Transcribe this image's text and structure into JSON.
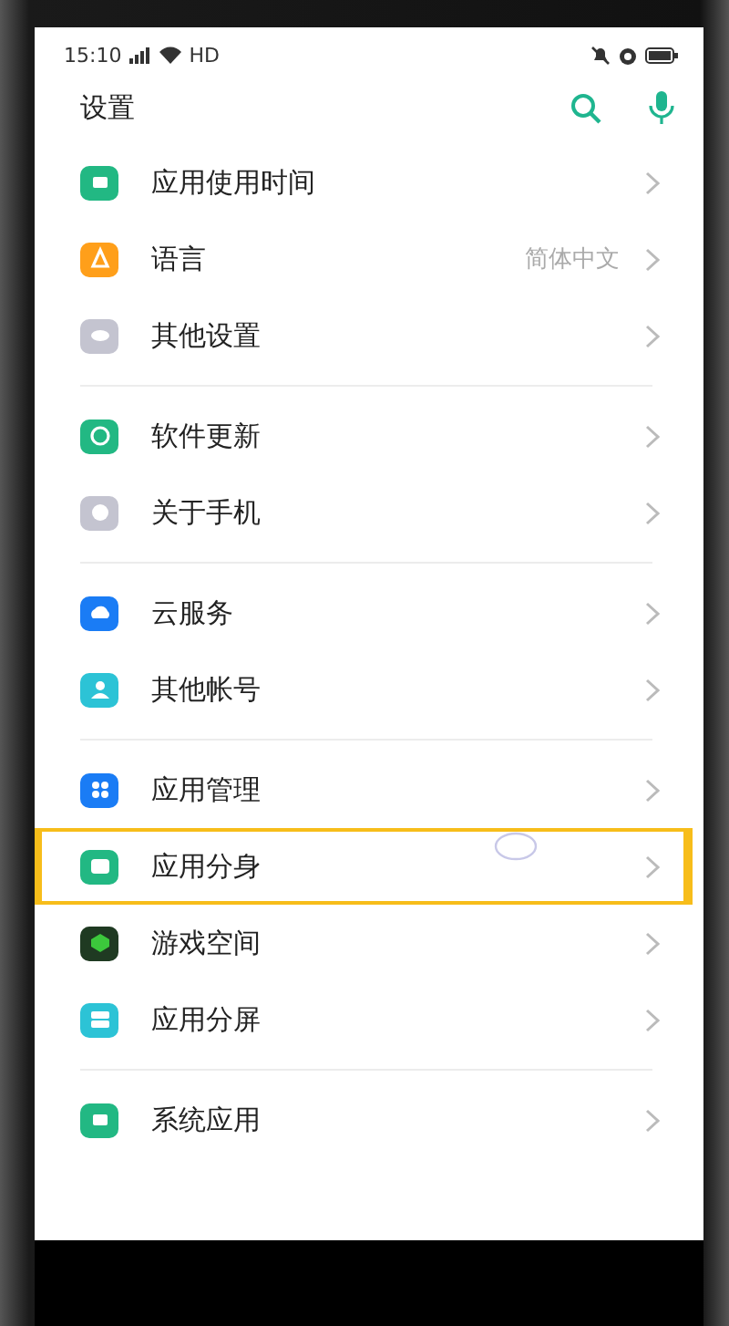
{
  "status_bar": {
    "time": "15:10",
    "network": "HD"
  },
  "header": {
    "title": "设置"
  },
  "sections": [
    {
      "items": [
        {
          "label": "应用使用时间",
          "color": "#22b883",
          "highlighted": false
        },
        {
          "label": "语言",
          "value": "简体中文",
          "color": "#ff9f1a",
          "highlighted": false
        },
        {
          "label": "其他设置",
          "color": "#c4c4d0",
          "highlighted": false
        }
      ]
    },
    {
      "items": [
        {
          "label": "软件更新",
          "color": "#22b883",
          "highlighted": false
        },
        {
          "label": "关于手机",
          "color": "#c4c4d0",
          "highlighted": false
        }
      ]
    },
    {
      "items": [
        {
          "label": "云服务",
          "color": "#1a7cf5",
          "highlighted": false
        },
        {
          "label": "其他帐号",
          "color": "#2cc3d6",
          "highlighted": false
        }
      ]
    },
    {
      "items": [
        {
          "label": "应用管理",
          "color": "#1a7cf5",
          "highlighted": false
        },
        {
          "label": "应用分身",
          "color": "#22b883",
          "highlighted": true
        },
        {
          "label": "游戏空间",
          "color": "#1f3a22",
          "highlighted": false
        },
        {
          "label": "应用分屏",
          "color": "#2cc3d6",
          "highlighted": false
        }
      ]
    },
    {
      "items": [
        {
          "label": "系统应用",
          "color": "#22b883",
          "highlighted": false
        }
      ]
    }
  ]
}
